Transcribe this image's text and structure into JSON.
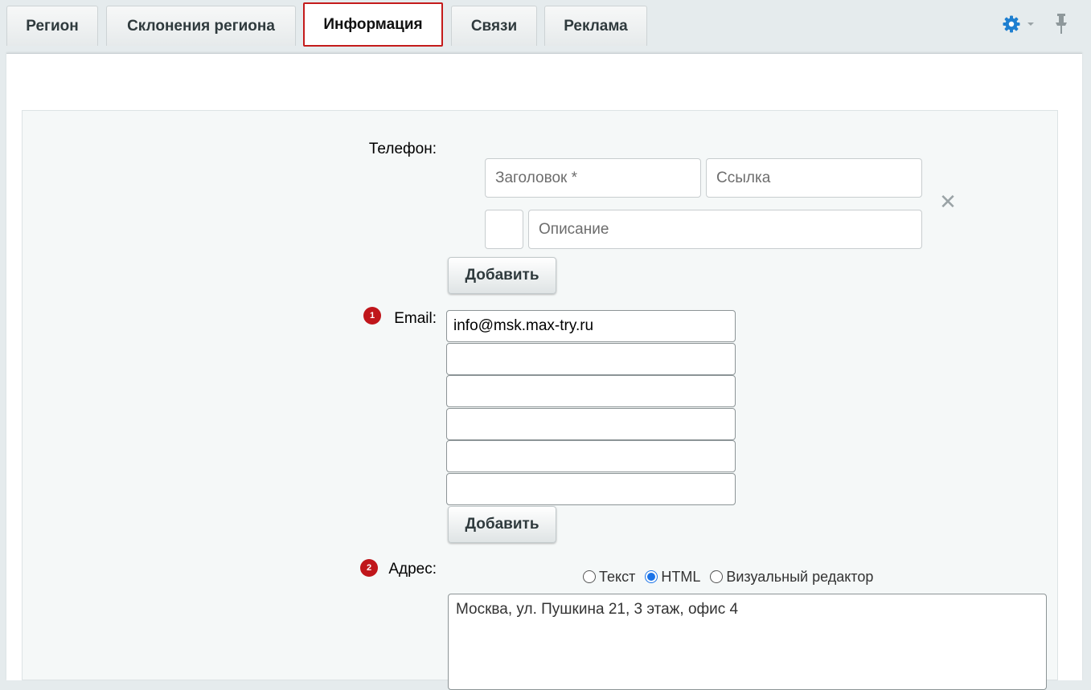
{
  "tabs": [
    {
      "label": "Регион"
    },
    {
      "label": "Склонения региона"
    },
    {
      "label": "Информация",
      "active": true
    },
    {
      "label": "Связи"
    },
    {
      "label": "Реклама"
    }
  ],
  "form": {
    "phone": {
      "label": "Телефон:",
      "title_placeholder": "Заголовок *",
      "link_placeholder": "Ссылка",
      "description_placeholder": "Описание",
      "remove_glyph": "✕",
      "add_label": "Добавить"
    },
    "email": {
      "badge": "1",
      "label": "Email:",
      "values": [
        "info@msk.max-try.ru",
        "",
        "",
        "",
        "",
        ""
      ],
      "add_label": "Добавить"
    },
    "address": {
      "badge": "2",
      "label": "Адрес:",
      "modes": [
        {
          "label": "Текст",
          "selected": false
        },
        {
          "label": "HTML",
          "selected": true
        },
        {
          "label": "Визуальный редактор",
          "selected": false
        }
      ],
      "value": "Москва, ул. Пушкина 21, 3 этаж, офис 4"
    }
  },
  "colors": {
    "active_tab_border": "#c41b1b",
    "badge": "#c0161b",
    "gear": "#1e7fd0"
  },
  "icons": {
    "settings": "gear-icon",
    "settings_menu": "chevron-down-icon",
    "pin": "pin-icon"
  }
}
